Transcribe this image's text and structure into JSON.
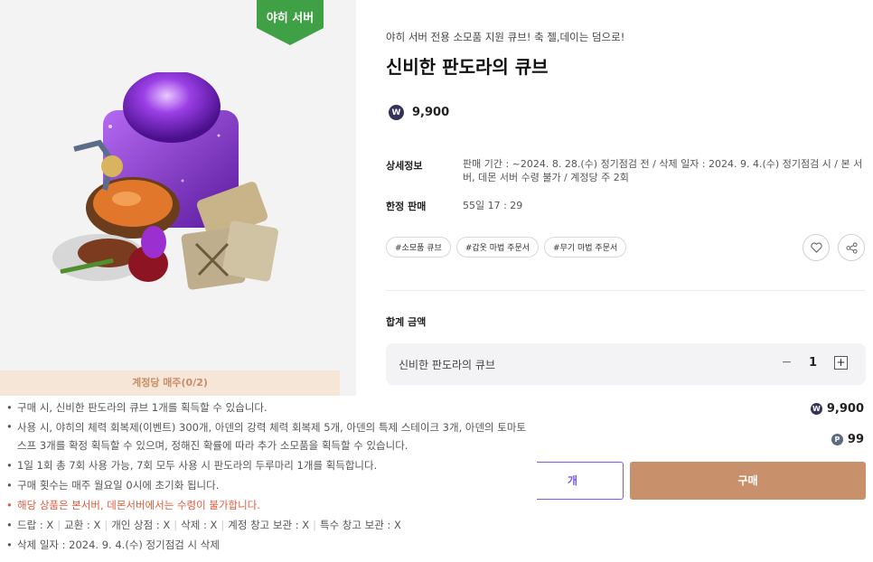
{
  "badge": "야히 서버",
  "limit_bar": "계정당 매주(0/2)",
  "product": {
    "subtitle": "야히 서버 전용 소모품 지원 큐브! 축 젤,데이는 덤으로!",
    "title": "신비한 판도라의 큐브",
    "price_coin_icon": "won-coin-icon",
    "price": "9,900"
  },
  "details": {
    "label": "상세정보",
    "text": "판매 기간 : ~2024. 8. 28.(수) 정기점검 전 / 삭제 일자 : 2024. 9. 4.(수) 정기점검 시 / 본 서버, 데몬 서버 수령 불가 / 계정당 주 2회",
    "limited_label": "한정 판매",
    "limited_value": "55일 17 : 29"
  },
  "tags": [
    "#소모품 큐브",
    "#갑옷 마법 주문서",
    "#무기 마법 주문서"
  ],
  "total": {
    "label": "합계 금액",
    "item_name": "신비한 판도라의 큐브",
    "quantity": "1",
    "amount_w": "9,900",
    "amount_p": "99"
  },
  "colors": {
    "badge": "#3fa046",
    "buy": "#c8916b",
    "gift": "#7e5ae0",
    "warn": "#e05a3c"
  },
  "buttons": {
    "gift_partial": "개",
    "buy": "구매"
  },
  "description": [
    "구매 시, 신비한 판도라의 큐브 1개를 획득할 수 있습니다.",
    "사용 시, 야히의 체력 회복제(이벤트) 300개, 아덴의 강력 체력 회복제 5개, 아덴의 특제 스테이크 3개, 아덴의 토마토 스프 3개를 확정 획득할 수 있으며, 정해진 확률에 따라 추가 소모품을 획득할 수 있습니다.",
    "1일 1회 총 7회 사용 가능, 7회 모두 사용 시 판도라의 두루마리 1개를 획득합니다.",
    "구매 횟수는 매주 월요일 0시에 초기화 됩니다.",
    "해당 상품은 본서버, 데몬서버에서는 수령이 불가합니다.",
    [
      "드랍 : X",
      "교환 : X",
      "개인 상점 : X",
      "삭제 : X",
      "계정 창고 보관 : X",
      "특수 창고 보관 : X"
    ],
    "삭제 일자 : 2024. 9. 4.(수) 정기점검 시 삭제"
  ]
}
